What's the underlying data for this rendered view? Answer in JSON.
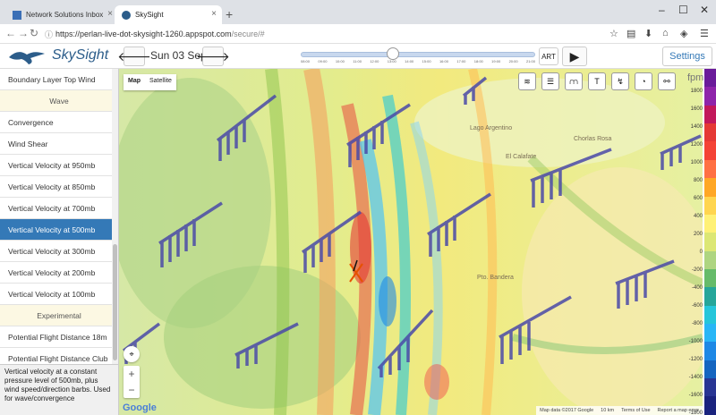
{
  "browser": {
    "tabs": [
      {
        "label": "Network Solutions Inbox"
      },
      {
        "label": "SkySight"
      }
    ],
    "url_host": "https://perlan-live-dot-skysight-1260.appspot.com",
    "url_path": "/secure/#"
  },
  "app": {
    "brand": "SkySight",
    "date": "Sun 03 Sep",
    "timezone": "ART",
    "settings_label": "Settings",
    "time_ticks": [
      "08:00",
      "09:00",
      "10:00",
      "11:00",
      "12:00",
      "13:00",
      "14:00",
      "15:00",
      "16:00",
      "17:00",
      "18:00",
      "19:00",
      "20:00",
      "21:00"
    ],
    "time_value": "12:00"
  },
  "sidebar": {
    "items": [
      {
        "label": "Boundary Layer Top Wind",
        "type": "item"
      },
      {
        "label": "Wave",
        "type": "header"
      },
      {
        "label": "Convergence",
        "type": "item"
      },
      {
        "label": "Wind Shear",
        "type": "item"
      },
      {
        "label": "Vertical Velocity at 950mb",
        "type": "item"
      },
      {
        "label": "Vertical Velocity at 850mb",
        "type": "item"
      },
      {
        "label": "Vertical Velocity at 700mb",
        "type": "item"
      },
      {
        "label": "Vertical Velocity at 500mb",
        "type": "selected"
      },
      {
        "label": "Vertical Velocity at 300mb",
        "type": "item"
      },
      {
        "label": "Vertical Velocity at 200mb",
        "type": "item"
      },
      {
        "label": "Vertical Velocity at 100mb",
        "type": "item"
      },
      {
        "label": "Experimental",
        "type": "header"
      },
      {
        "label": "Potential Flight Distance 18m",
        "type": "item"
      },
      {
        "label": "Potential Flight Distance Club",
        "type": "item"
      }
    ],
    "description": "Vertical velocity at a constant pressure level of 500mb, plus wind speed/direction barbs. Used for wave/convergence"
  },
  "map": {
    "map_type": {
      "map": "Map",
      "satellite": "Satellite"
    },
    "tools": [
      {
        "icon": "wind-icon",
        "glyph": "≋"
      },
      {
        "icon": "layers-list-icon",
        "glyph": "☰"
      },
      {
        "icon": "cloud-base-icon",
        "glyph": "⩋"
      },
      {
        "icon": "skewt-icon",
        "glyph": "T"
      },
      {
        "icon": "route-icon",
        "glyph": "↯"
      },
      {
        "icon": "satellite-dish-icon",
        "glyph": "◔"
      },
      {
        "icon": "waypoint-icon",
        "glyph": "⚯"
      }
    ],
    "place_labels": [
      "Lago Argentino",
      "El Calafate",
      "Chorlas Rosa",
      "Pto. Bandera"
    ],
    "attribution": {
      "data": "Map data ©2017 Google",
      "scale": "10 km",
      "terms": "Terms of Use",
      "report": "Report a map error"
    },
    "google": "Google",
    "zoom_in": "+",
    "zoom_out": "−"
  },
  "legend": {
    "unit": "fpm",
    "labels": [
      "1800",
      "1600",
      "1400",
      "1200",
      "1000",
      "800",
      "600",
      "400",
      "200",
      "0",
      "-200",
      "-400",
      "-600",
      "-800",
      "-1000",
      "-1200",
      "-1400",
      "-1600",
      "-1800"
    ],
    "colors": [
      "#6a1b9a",
      "#8e24aa",
      "#c2185b",
      "#e53935",
      "#f44336",
      "#ff7043",
      "#ffa726",
      "#ffd54f",
      "#fff176",
      "#dce775",
      "#aed581",
      "#66bb6a",
      "#26a69a",
      "#26c6da",
      "#29b6f6",
      "#1e88e5",
      "#1565c0",
      "#283593",
      "#1a237e"
    ]
  }
}
